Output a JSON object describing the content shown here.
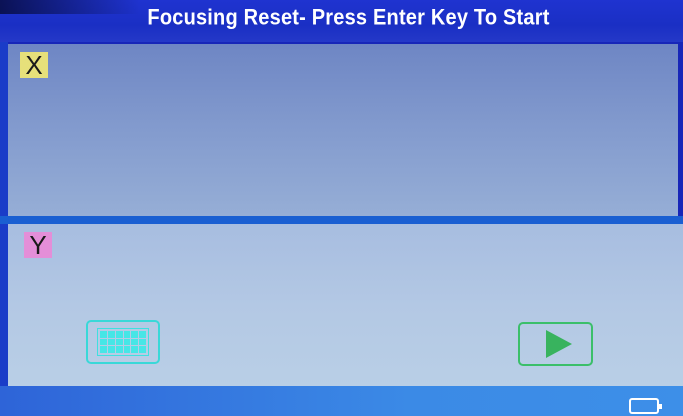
{
  "header": {
    "title": "Focusing Reset- Press Enter Key To Start"
  },
  "panels": {
    "x": {
      "label": "X",
      "tag_color": "#e6e07a"
    },
    "y": {
      "label": "Y",
      "tag_color": "#e48ed8"
    }
  },
  "controls": {
    "grid_button_icon": "grid-icon",
    "play_button_icon": "play-icon"
  },
  "status_bar": {
    "battery_icon": "battery-icon"
  },
  "colors": {
    "title_bar": "#1a2fc4",
    "grid_button": "#39d8d8",
    "play_button": "#3bbf6a",
    "bottom_bar": "#3b8ae6"
  }
}
